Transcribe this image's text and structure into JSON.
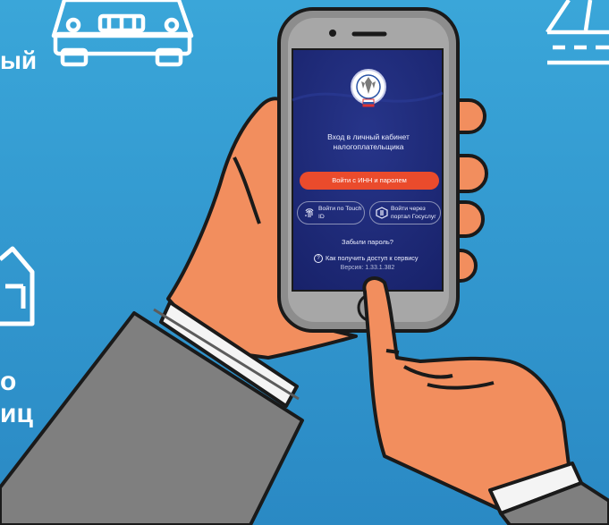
{
  "side_text": {
    "frag_top": "ый",
    "frag_mid": "о",
    "frag_bottom": "иц"
  },
  "app_screen": {
    "title": "Вход в личный кабинет налогоплательщика",
    "login_button": "Войти с ИНН и паролем",
    "touch_id_button": "Войти по Touch ID",
    "gosuslugi_button": "Войти через портал Госуслуг",
    "forgot_password": "Забыли пароль?",
    "access_link": "Как получить доступ к сервису",
    "version": "Версия: 1.33.1.382"
  },
  "colors": {
    "background": "#2f9ad0",
    "screen": "#1d2a75",
    "login_button": "#ea4b2c",
    "phone_body": "#8d8d8d",
    "skin": "#f28e5e",
    "sleeve": "#7f7f7f"
  },
  "icons": [
    "car-icon",
    "house-icon",
    "road-icon",
    "fns-emblem-icon",
    "fingerprint-icon",
    "gosuslugi-icon",
    "question-icon"
  ]
}
